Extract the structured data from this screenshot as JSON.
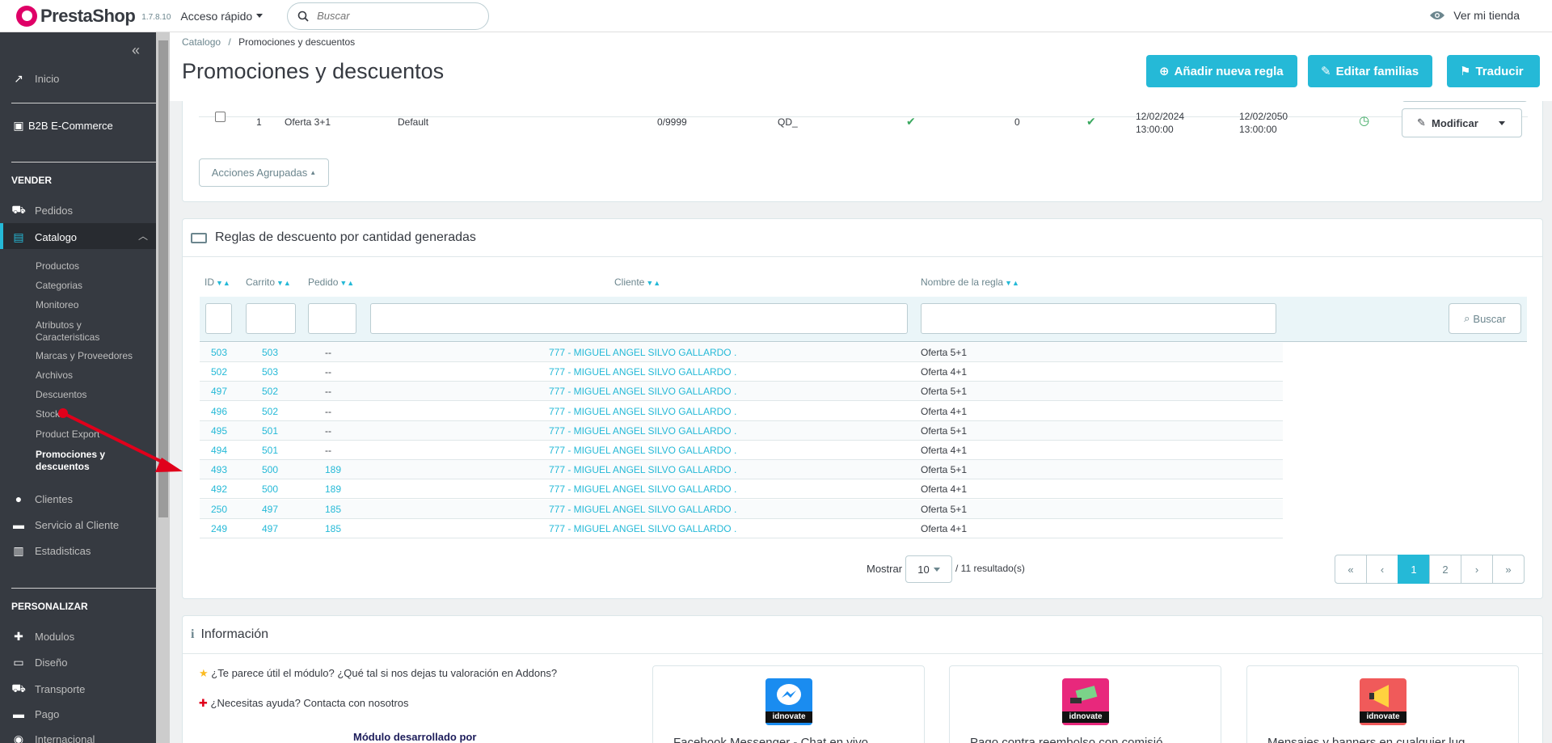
{
  "header": {
    "brand": "PrestaShop",
    "version": "1.7.8.10",
    "quick_access": "Acceso rápido",
    "search_placeholder": "Buscar",
    "view_store": "Ver mi tienda"
  },
  "sidebar": {
    "home": "Inicio",
    "b2b": "B2B E-Commerce",
    "section_sell": "VENDER",
    "orders": "Pedidos",
    "catalog": "Catalogo",
    "catalog_sub": [
      "Productos",
      "Categorias",
      "Monitoreo",
      "Atributos y Caracteristicas",
      "Marcas y Proveedores",
      "Archivos",
      "Descuentos",
      "Stock",
      "Product Export",
      "Promociones y descuentos"
    ],
    "customers": "Clientes",
    "customer_service": "Servicio al Cliente",
    "stats": "Estadisticas",
    "section_customize": "PERSONALIZAR",
    "modules": "Modulos",
    "design": "Diseño",
    "shipping": "Transporte",
    "payment": "Pago",
    "international": "Internacional"
  },
  "page": {
    "breadcrumb_root": "Catalogo",
    "breadcrumb_sep": "/",
    "breadcrumb_current": "Promociones y descuentos",
    "title": "Promociones y descuentos",
    "btn_add": "Añadir nueva regla",
    "btn_families": "Editar familias",
    "btn_translate": "Traducir"
  },
  "rules_row": {
    "id": "1",
    "name": "Oferta 3+1",
    "group": "Default",
    "quantity": "0/9999",
    "code": "QD_",
    "priority": "0",
    "date_from_1": "12/02/2024",
    "date_from_2": "13:00:00",
    "date_to_1": "12/02/2050",
    "date_to_2": "13:00:00",
    "btn_modify": "Modificar",
    "bulk_actions": "Acciones Agrupadas"
  },
  "generated": {
    "title": "Reglas de descuento por cantidad generadas",
    "columns": [
      "ID",
      "Carrito",
      "Pedido",
      "Cliente",
      "Nombre de la regla"
    ],
    "btn_search": "Buscar",
    "rows": [
      {
        "id": "503",
        "cart": "503",
        "order": "--",
        "customer": "777 - MIGUEL ANGEL SILVO GALLARDO .",
        "rule": "Oferta 5+1"
      },
      {
        "id": "502",
        "cart": "503",
        "order": "--",
        "customer": "777 - MIGUEL ANGEL SILVO GALLARDO .",
        "rule": "Oferta 4+1"
      },
      {
        "id": "497",
        "cart": "502",
        "order": "--",
        "customer": "777 - MIGUEL ANGEL SILVO GALLARDO .",
        "rule": "Oferta 5+1"
      },
      {
        "id": "496",
        "cart": "502",
        "order": "--",
        "customer": "777 - MIGUEL ANGEL SILVO GALLARDO .",
        "rule": "Oferta 4+1"
      },
      {
        "id": "495",
        "cart": "501",
        "order": "--",
        "customer": "777 - MIGUEL ANGEL SILVO GALLARDO .",
        "rule": "Oferta 5+1"
      },
      {
        "id": "494",
        "cart": "501",
        "order": "--",
        "customer": "777 - MIGUEL ANGEL SILVO GALLARDO .",
        "rule": "Oferta 4+1"
      },
      {
        "id": "493",
        "cart": "500",
        "order": "189",
        "customer": "777 - MIGUEL ANGEL SILVO GALLARDO .",
        "rule": "Oferta 5+1"
      },
      {
        "id": "492",
        "cart": "500",
        "order": "189",
        "customer": "777 - MIGUEL ANGEL SILVO GALLARDO .",
        "rule": "Oferta 4+1"
      },
      {
        "id": "250",
        "cart": "497",
        "order": "185",
        "customer": "777 - MIGUEL ANGEL SILVO GALLARDO .",
        "rule": "Oferta 5+1"
      },
      {
        "id": "249",
        "cart": "497",
        "order": "185",
        "customer": "777 - MIGUEL ANGEL SILVO GALLARDO .",
        "rule": "Oferta 4+1"
      }
    ],
    "show_label": "Mostrar",
    "per_page": "10",
    "results": "/ 11 resultado(s)",
    "pages": [
      "«",
      "‹",
      "1",
      "2",
      "›",
      "»"
    ]
  },
  "info": {
    "title": "Información",
    "rate_text": "¿Te parece útil el módulo? ¿Qué tal si nos dejas tu valoración en Addons?",
    "help_text": "¿Necesitas ayuda? Contacta con nosotros",
    "developed_by": "Módulo desarrollado por",
    "cards": [
      {
        "label": "Facebook Messenger - Chat en vivo",
        "logo_text": "idnovate",
        "color": "#1a8cf0"
      },
      {
        "label": "Pago contra reembolso con comisió",
        "logo_text": "idnovate",
        "color": "#e8287c"
      },
      {
        "label": "Mensajes y banners en cualquier lug",
        "logo_text": "idnovate",
        "color": "#f05a5a"
      }
    ]
  },
  "colors": {
    "accent": "#25b9d7",
    "sidebar": "#363a41",
    "success": "#3aa85f",
    "arrow": "#e0001b"
  }
}
